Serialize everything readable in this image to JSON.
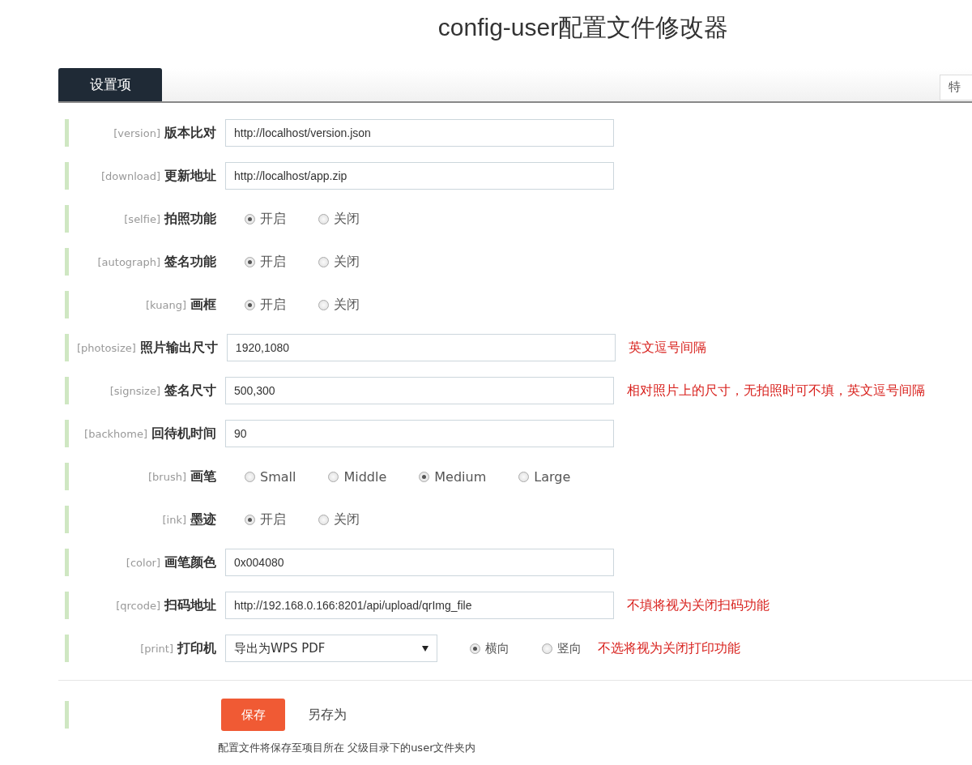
{
  "title": "config-user配置文件修改器",
  "tabs": [
    {
      "label": "设置项",
      "selected": true
    }
  ],
  "search": {
    "value": "特"
  },
  "rows": [
    {
      "kind": "text",
      "key": "[version]",
      "label": "版本比对",
      "value": "http://localhost/version.json"
    },
    {
      "kind": "text",
      "key": "[download]",
      "label": "更新地址",
      "value": "http://localhost/app.zip"
    },
    {
      "kind": "radio",
      "key": "[selfie]",
      "label": "拍照功能",
      "options": [
        {
          "label": "开启",
          "selected": true
        },
        {
          "label": "关闭",
          "selected": false
        }
      ]
    },
    {
      "kind": "radio",
      "key": "[autograph]",
      "label": "签名功能",
      "options": [
        {
          "label": "开启",
          "selected": true
        },
        {
          "label": "关闭",
          "selected": false
        }
      ]
    },
    {
      "kind": "radio",
      "key": "[kuang]",
      "label": "画框",
      "options": [
        {
          "label": "开启",
          "selected": true
        },
        {
          "label": "关闭",
          "selected": false
        }
      ]
    },
    {
      "kind": "text",
      "key": "[photosize]",
      "label": "照片输出尺寸",
      "value": "1920,1080",
      "note": "英文逗号间隔"
    },
    {
      "kind": "text",
      "key": "[signsize]",
      "label": "签名尺寸",
      "value": "500,300",
      "note": "相对照片上的尺寸，无拍照时可不填，英文逗号间隔"
    },
    {
      "kind": "text",
      "key": "[backhome]",
      "label": "回待机时间",
      "value": "90"
    },
    {
      "kind": "radio",
      "key": "[brush]",
      "label": "画笔",
      "options": [
        {
          "label": "Small",
          "selected": false
        },
        {
          "label": "Middle",
          "selected": false
        },
        {
          "label": "Medium",
          "selected": true
        },
        {
          "label": "Large",
          "selected": false
        }
      ]
    },
    {
      "kind": "radio",
      "key": "[ink]",
      "label": "墨迹",
      "options": [
        {
          "label": "开启",
          "selected": true
        },
        {
          "label": "关闭",
          "selected": false
        }
      ]
    },
    {
      "kind": "text",
      "key": "[color]",
      "label": "画笔颜色",
      "value": "0x004080"
    },
    {
      "kind": "text",
      "key": "[qrcode]",
      "label": "扫码地址",
      "value": "http://192.168.0.166:8201/api/upload/qrImg_file",
      "note": "不填将视为关闭扫码功能"
    },
    {
      "kind": "select",
      "key": "[print]",
      "label": "打印机",
      "value": "导出为WPS PDF",
      "options": [
        {
          "label": "横向",
          "selected": true
        },
        {
          "label": "竖向",
          "selected": false
        }
      ],
      "note": "不选将视为关闭打印功能"
    }
  ],
  "footer": {
    "save": "保存",
    "save_as": "另存为",
    "caption": "配置文件将保存至项目所在 父级目录下的user文件夹内"
  }
}
